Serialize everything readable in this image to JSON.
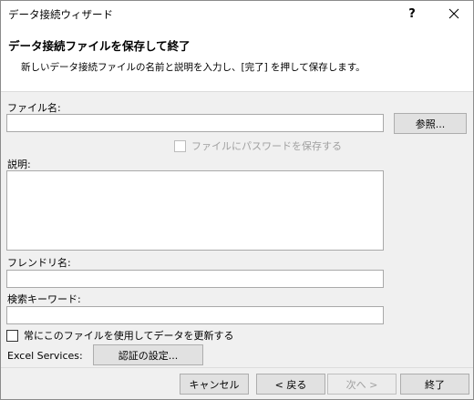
{
  "window": {
    "title": "データ接続ウィザード",
    "help_label": "?"
  },
  "header": {
    "heading": "データ接続ファイルを保存して終了",
    "description": "新しいデータ接続ファイルの名前と説明を入力し、[完了] を押して保存します。"
  },
  "form": {
    "filename_label": "ファイル名:",
    "filename_value": "",
    "browse_label": "参照...",
    "save_password_label": "ファイルにパスワードを保存する",
    "description_label": "説明:",
    "description_value": "",
    "friendly_name_label": "フレンドリ名:",
    "friendly_name_value": "",
    "keywords_label": "検索キーワード:",
    "keywords_value": "",
    "always_use_label": "常にこのファイルを使用してデータを更新する",
    "excel_services_label": "Excel Services:",
    "auth_settings_label": "認証の設定..."
  },
  "footer": {
    "cancel_label": "キャンセル",
    "back_label": "< 戻る",
    "next_label": "次へ >",
    "finish_label": "終了"
  }
}
